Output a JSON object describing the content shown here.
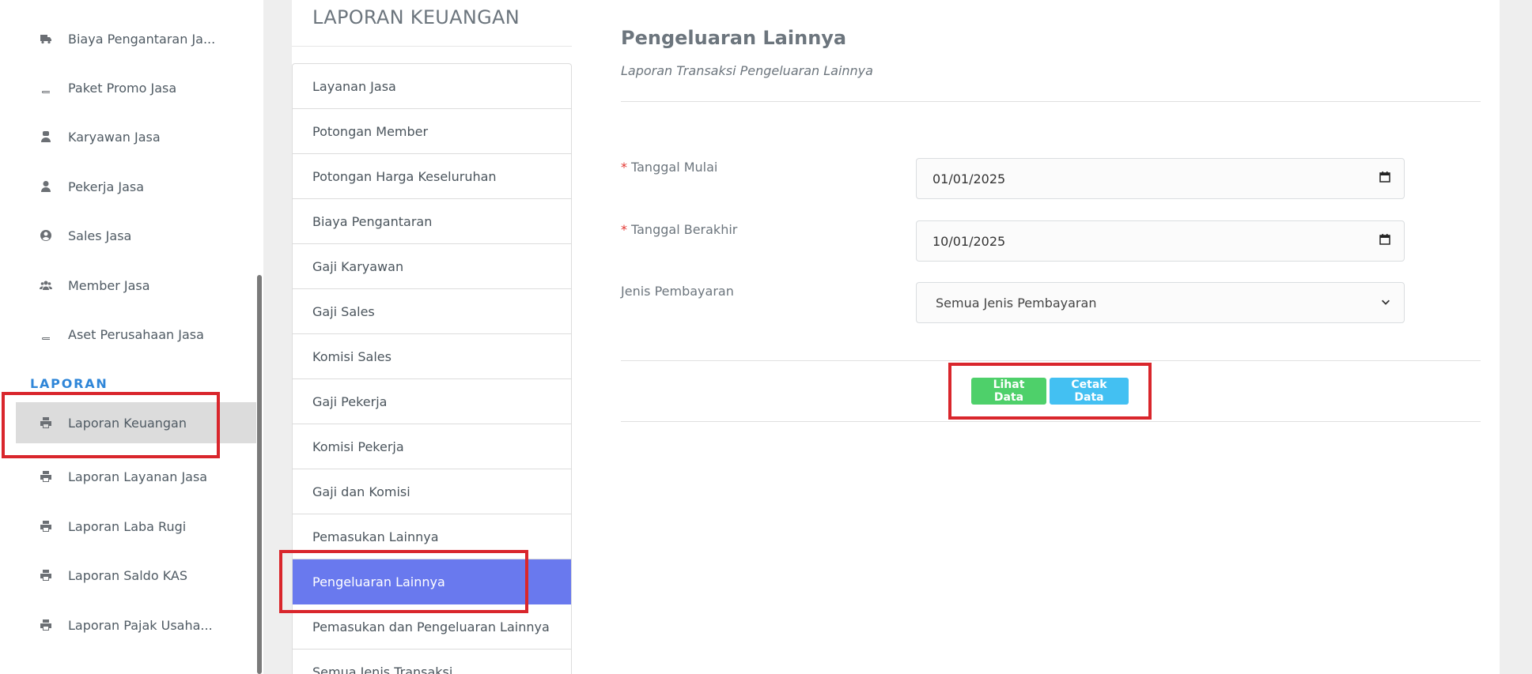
{
  "sidebar": {
    "items_top": [
      {
        "label": "Biaya Pengantaran Ja...",
        "icon": "truck-icon"
      },
      {
        "label": "Paket Promo Jasa",
        "icon": "book-icon"
      },
      {
        "label": "Karyawan Jasa",
        "icon": "user-tie-icon"
      },
      {
        "label": "Pekerja Jasa",
        "icon": "user-icon"
      },
      {
        "label": "Sales Jasa",
        "icon": "user-circle-icon"
      },
      {
        "label": "Member Jasa",
        "icon": "users-icon"
      },
      {
        "label": "Aset Perusahaan Jasa",
        "icon": "book-icon"
      }
    ],
    "section_heading": "LAPORAN",
    "items_laporan": [
      {
        "label": "Laporan Keuangan",
        "icon": "print-icon",
        "active": true
      },
      {
        "label": "Laporan Layanan Jasa",
        "icon": "print-icon"
      },
      {
        "label": "Laporan Laba Rugi",
        "icon": "print-icon"
      },
      {
        "label": "Laporan Saldo KAS",
        "icon": "print-icon"
      },
      {
        "label": "Laporan Pajak Usaha...",
        "icon": "print-icon"
      }
    ]
  },
  "report_menu": {
    "title": "LAPORAN KEUANGAN",
    "items": [
      "Layanan Jasa",
      "Potongan Member",
      "Potongan Harga Keseluruhan",
      "Biaya Pengantaran",
      "Gaji Karyawan",
      "Gaji Sales",
      "Komisi Sales",
      "Gaji Pekerja",
      "Komisi Pekerja",
      "Gaji dan Komisi",
      "Pemasukan Lainnya",
      "Pengeluaran Lainnya",
      "Pemasukan dan Pengeluaran Lainnya",
      "Semua Jenis Transaksi"
    ],
    "active_item": "Pengeluaran Lainnya"
  },
  "form": {
    "title": "Pengeluaran Lainnya",
    "subtitle": "Laporan Transaksi Pengeluaran Lainnya",
    "required_mark": "*",
    "start_date_label": "Tanggal Mulai",
    "start_date_value": "01/01/2025",
    "end_date_label": "Tanggal Berakhir",
    "end_date_value": "10/01/2025",
    "payment_label": "Jenis Pembayaran",
    "payment_value": "Semua Jenis Pembayaran",
    "view_button": "Lihat Data",
    "print_button": "Cetak Data"
  },
  "colors": {
    "accent_active": "#6979ee",
    "heading_blue": "#2f86d8",
    "btn_green": "#4ed06a",
    "btn_blue": "#43c0f2",
    "highlight_red": "#d9262c"
  }
}
